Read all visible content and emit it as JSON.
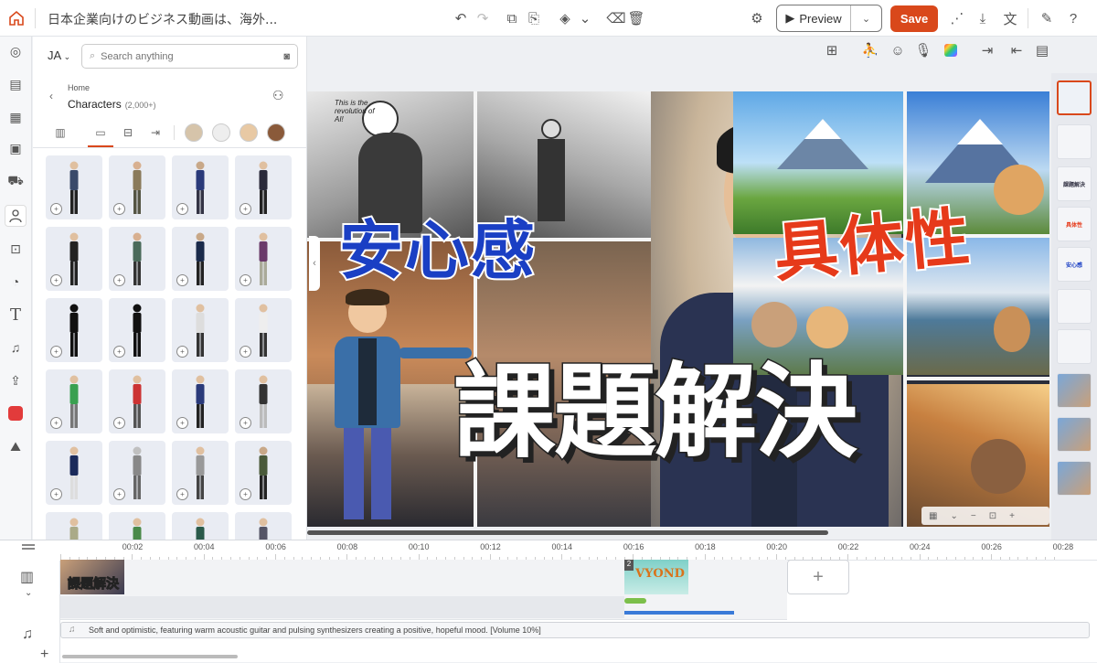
{
  "app": {
    "doc_title": "日本企業向けのビジネス動画は、海外...",
    "preview_label": "Preview",
    "save_label": "Save"
  },
  "colors": {
    "accent": "#d9481b",
    "blue_text": "#1a3fc4",
    "red_text": "#e63a1a"
  },
  "top_icons": [
    "home-icon",
    "undo-icon",
    "redo-icon",
    "copy-icon",
    "paste-icon",
    "layers-icon",
    "chevron-down-icon",
    "eraser-icon",
    "trash-icon",
    "settings-icon",
    "share-icon",
    "download-icon",
    "translate-icon",
    "edit-notes-icon",
    "help-icon"
  ],
  "rail_icons": [
    "compass-icon",
    "scenes-icon",
    "template-icon",
    "media-icon",
    "props-icon",
    "characters-icon",
    "character-creator-icon",
    "chart-icon",
    "text-icon",
    "music-icon",
    "upload-icon",
    "brand-icon",
    "image-ai-icon"
  ],
  "panel": {
    "language": "JA",
    "search_placeholder": "Search anything",
    "breadcrumb": "Home",
    "title": "Characters",
    "count": "(2,000+)"
  },
  "slide": {
    "text_anshin": "安心感",
    "text_gutaisei": "具体性",
    "text_kadai": "課題解決",
    "comic_text": "This is the revolution of AI!"
  },
  "thumbs": [
    "",
    "",
    "課題解決",
    "具体性",
    "安心感",
    "",
    "",
    "",
    "",
    ""
  ],
  "timeline": {
    "ticks": [
      "00:02",
      "00:04",
      "00:06",
      "00:08",
      "00:10",
      "00:12",
      "00:14",
      "00:16",
      "00:18",
      "00:20",
      "00:22",
      "00:24",
      "00:26",
      "00:28"
    ],
    "scene2_label": "VYOND",
    "scene2_number": "2",
    "scene1_label": "課題解決",
    "audio_text": "Soft and optimistic, featuring warm acoustic guitar and pulsing synthesizers creating a positive, hopeful mood. [Volume 10%]"
  }
}
